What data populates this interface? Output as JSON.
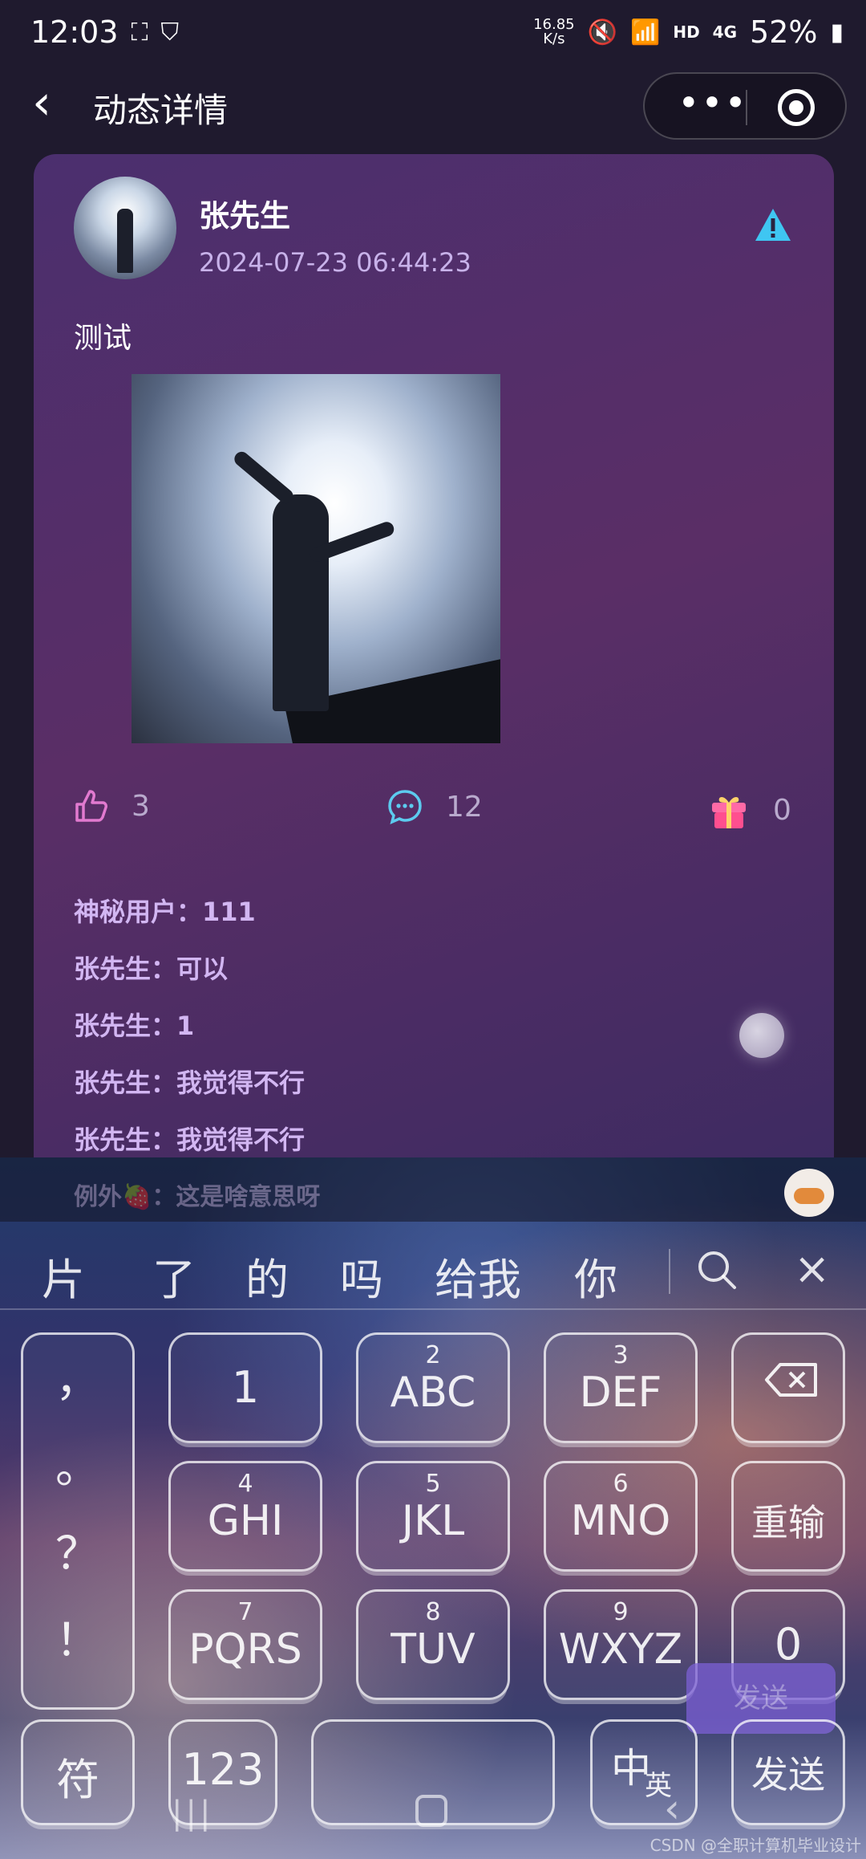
{
  "status_bar": {
    "time": "12:03",
    "speed_value": "16.85",
    "speed_unit": "K/s",
    "network_label": "HD",
    "cell_label": "4G",
    "battery": "52%"
  },
  "nav": {
    "title": "动态详情",
    "more_label": "•••"
  },
  "post": {
    "author": "张先生",
    "timestamp": "2024-07-23 06:44:23",
    "text": "测试"
  },
  "actions": {
    "likes": "3",
    "comments": "12",
    "gifts": "0"
  },
  "comments": [
    "神秘用户：111",
    "张先生：可以",
    "张先生：1",
    "张先生：我觉得不行",
    "张先生：我觉得不行"
  ],
  "peek_comment": "例外🍓：这是啥意思呀",
  "keyboard": {
    "candidates": [
      "片",
      "了",
      "的",
      "吗",
      "给我",
      "你"
    ],
    "punct": [
      "，",
      "。",
      "？",
      "！"
    ],
    "keys": [
      {
        "num": "",
        "label": "1"
      },
      {
        "num": "2",
        "label": "ABC"
      },
      {
        "num": "3",
        "label": "DEF"
      },
      {
        "num": "4",
        "label": "GHI"
      },
      {
        "num": "5",
        "label": "JKL"
      },
      {
        "num": "6",
        "label": "MNO"
      },
      {
        "num": "7",
        "label": "PQRS"
      },
      {
        "num": "8",
        "label": "TUV"
      },
      {
        "num": "9",
        "label": "WXYZ"
      }
    ],
    "reset_label": "重输",
    "zero_label": "0",
    "symbol_label": "符",
    "num123_label": "123",
    "space_label": "",
    "lang_main": "中",
    "lang_sub": "英",
    "send_label": "发送",
    "send_ghost": "发送"
  },
  "watermark": "CSDN @全职计算机毕业设计"
}
